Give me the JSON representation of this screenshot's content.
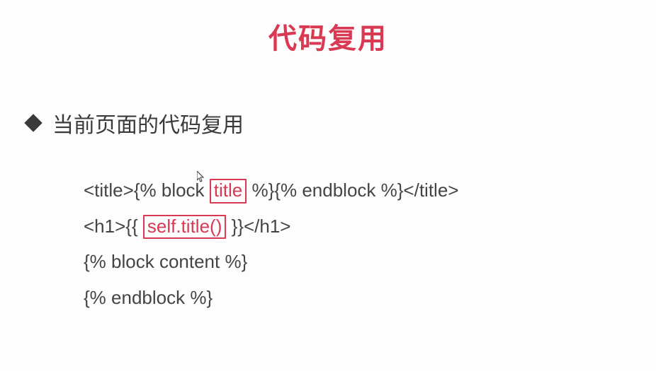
{
  "title": "代码复用",
  "bullet": "当前页面的代码复用",
  "code": {
    "line1_a": "<title>{% block",
    "line1_hl": "title",
    "line1_b": "%}{% endblock %}</title>",
    "line2_a": "<h1>{{",
    "line2_hl": "self.title()",
    "line2_b": "}}</h1>",
    "line3": "{% block content %}",
    "line4": "{% endblock %}"
  }
}
